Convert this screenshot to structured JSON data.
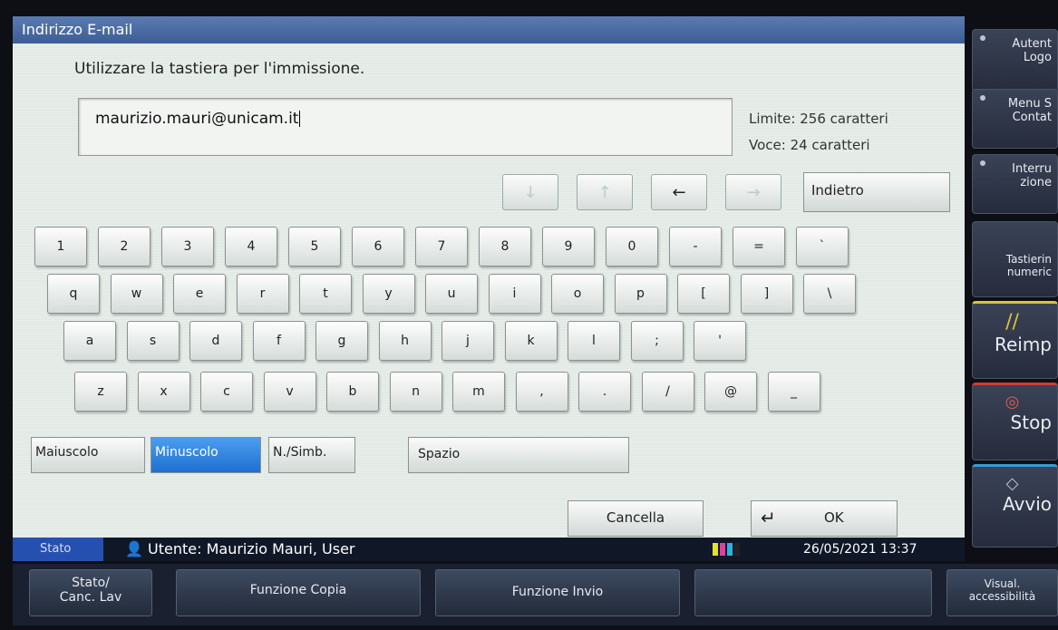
{
  "window_title": "Indirizzo E-mail",
  "instruction": "Utilizzare la tastiera per l'immissione.",
  "email_value": "maurizio.mauri@unicam.it",
  "limit_text": "Limite: 256 caratteri",
  "voce_text": "Voce: 24 caratteri",
  "nav": {
    "down": "↓",
    "up": "↑",
    "left": "←",
    "right": "→",
    "back_label": "Indietro"
  },
  "keys": {
    "row1": [
      "1",
      "2",
      "3",
      "4",
      "5",
      "6",
      "7",
      "8",
      "9",
      "0",
      "-",
      "=",
      "`"
    ],
    "row2": [
      "q",
      "w",
      "e",
      "r",
      "t",
      "y",
      "u",
      "i",
      "o",
      "p",
      "[",
      "]",
      "\\"
    ],
    "row3": [
      "a",
      "s",
      "d",
      "f",
      "g",
      "h",
      "j",
      "k",
      "l",
      ";",
      "'"
    ],
    "row4": [
      "z",
      "x",
      "c",
      "v",
      "b",
      "n",
      "m",
      ",",
      ".",
      "/",
      "@",
      "_"
    ]
  },
  "modes": {
    "upper": "Maiuscolo",
    "lower": "Minuscolo",
    "symbols": "N./Simb.",
    "space": "Spazio"
  },
  "actions": {
    "cancel": "Cancella",
    "ok": "OK"
  },
  "status": {
    "label": "Stato",
    "user": "Utente: Maurizio Mauri, User",
    "datetime": "26/05/2021 13:37",
    "toner_colors": [
      "#e8e030",
      "#e040a0",
      "#30b0e0",
      "#222222"
    ]
  },
  "function_bar": {
    "status_jobs": "Stato/\nCanc. Lav",
    "copy": "Funzione Copia",
    "send": "Funzione Invio",
    "accessibility": "Visual.\naccessibilità"
  },
  "side_panel": {
    "auth": "Autent\nLogo",
    "menu": "Menu S\nContat",
    "interrupt": "Interru\nzione",
    "numpad": "Tastierin\nnumeric",
    "reset": "Reimp",
    "stop": "Stop",
    "start": "Avvio"
  },
  "colors": {
    "selected": "#1f6fd0",
    "title": "#3d5e95"
  }
}
